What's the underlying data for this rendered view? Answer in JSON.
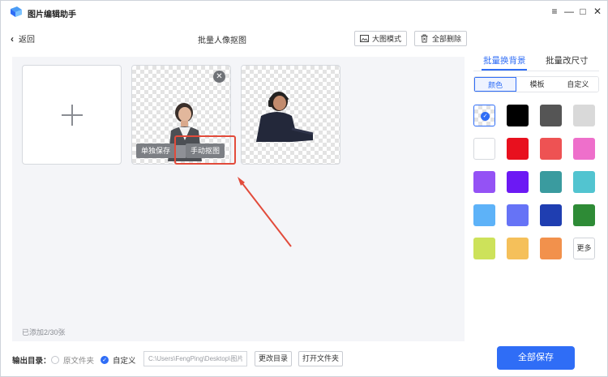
{
  "app": {
    "title": "图片编辑助手"
  },
  "window_controls": {
    "menu": "≡",
    "minimize": "—",
    "maximize": "□",
    "close": "✕"
  },
  "toolbar": {
    "back_label": "返回",
    "page_title": "批量人像抠图",
    "large_view_label": "大图模式",
    "delete_all_label": "全部删除"
  },
  "canvas": {
    "tiles": [
      {
        "kind": "add"
      },
      {
        "kind": "image",
        "subject": "woman-at-laptop",
        "buttons": {
          "save_single": "单独保存",
          "manual_cutout": "手动抠图"
        },
        "close": "✕"
      },
      {
        "kind": "image",
        "subject": "man-with-headphones"
      }
    ],
    "added_count": "已添加2/30张"
  },
  "output": {
    "label": "输出目录：",
    "option_original": "原文件夹",
    "option_custom": "自定义",
    "selected": "custom",
    "path_value": "C:\\Users\\FengPing\\Desktop\\图片",
    "change_dir_label": "更改目录",
    "open_folder_label": "打开文件夹",
    "save_all_label": "全部保存"
  },
  "right_panel": {
    "tabs": [
      "批量换背景",
      "批量改尺寸"
    ],
    "active_tab": 0,
    "subtabs": [
      "颜色",
      "模板",
      "自定义"
    ],
    "active_subtab": 0,
    "colors": [
      "transparent",
      "#000000",
      "#555555",
      "#d9d9d9",
      "#ffffff",
      "#e8101e",
      "#ee5253",
      "#ee6fcb",
      "#9452f5",
      "#6c19f4",
      "#3a9b9f",
      "#52c4d0",
      "#5db2f8",
      "#6673f6",
      "#1f3eb1",
      "#2e8b36",
      "#cde25a",
      "#f5c05a",
      "#f2914c"
    ],
    "selected_color": 0,
    "more_label": "更多"
  },
  "colors": {
    "accent": "#2f6df6",
    "annotation": "#e24b3b"
  }
}
